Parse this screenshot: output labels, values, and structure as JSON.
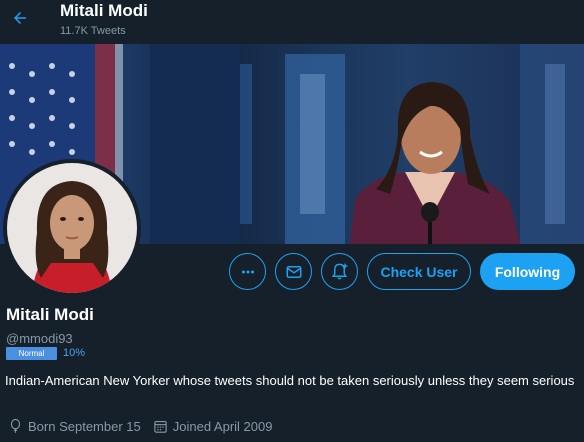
{
  "header": {
    "name": "Mitali Modi",
    "tweet_count": "11.7K Tweets",
    "back_icon": "arrow-left-icon"
  },
  "actions": {
    "more_icon": "more-horizontal-icon",
    "message_icon": "mail-icon",
    "notify_icon": "bell-plus-icon",
    "check_user_label": "Check User",
    "following_label": "Following"
  },
  "profile": {
    "display_name": "Mitali Modi",
    "handle": "@mmodi93",
    "badge": "Normal",
    "percent": "10%",
    "bio": "Indian-American New Yorker whose tweets should not be taken seriously unless they seem serious",
    "birthday": "Born September 15",
    "joined": "Joined April 2009"
  },
  "colors": {
    "background": "#15202b",
    "accent": "#1da1f2",
    "secondary_text": "#8899a6",
    "badge": "#4a8fe0"
  }
}
